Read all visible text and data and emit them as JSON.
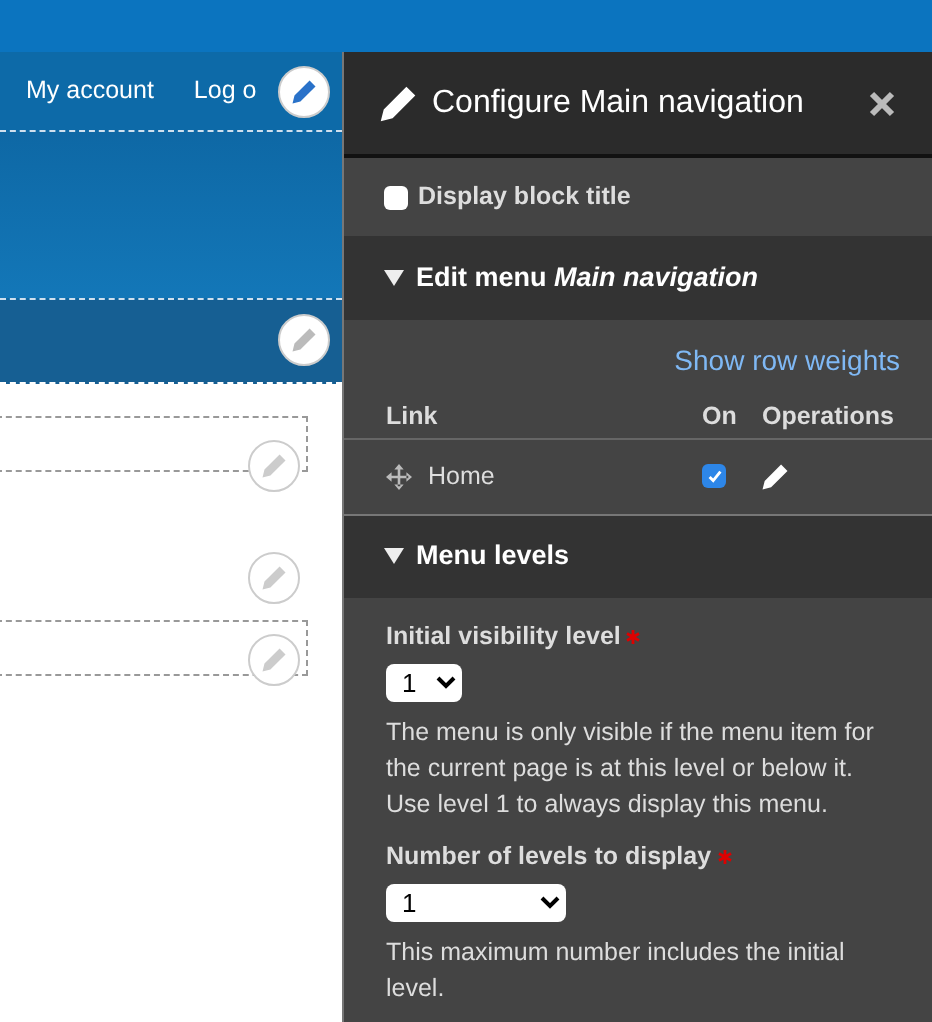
{
  "site_header": {
    "links": [
      "My account",
      "Log o"
    ]
  },
  "panel": {
    "title": "Configure Main navigation",
    "display_block_title": {
      "label": "Display block title",
      "checked": false
    },
    "edit_menu": {
      "title": "Edit menu *Main navigation*",
      "expanded": true,
      "show_row_weights": "Show row weights",
      "columns": [
        "Link",
        "On",
        "Operations"
      ],
      "rows": [
        {
          "link": "Home",
          "on": true
        }
      ]
    },
    "menu_levels": {
      "title": "Menu levels",
      "expanded": true,
      "fields": [
        {
          "label": "Initial visibility level",
          "required": true,
          "value": "1",
          "description": "The menu is only visible if the menu item for the current page is at this level or below it. Use level 1 to always display this menu."
        },
        {
          "label": "Number of levels to display",
          "required": true,
          "value": "1",
          "description": "This maximum number includes the initial level."
        }
      ]
    }
  }
}
